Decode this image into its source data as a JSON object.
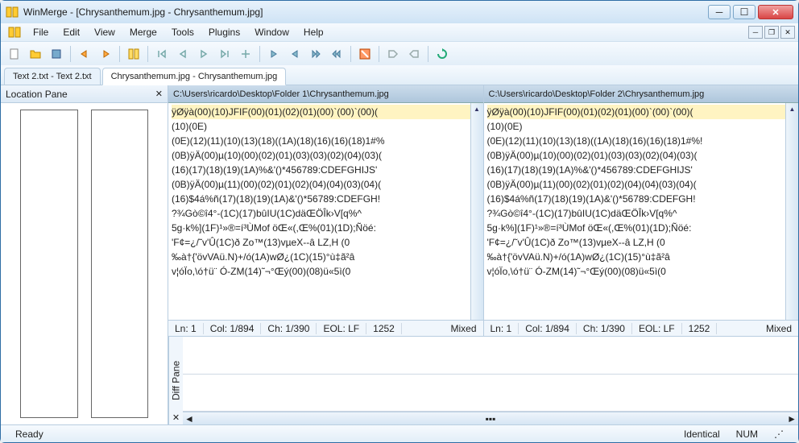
{
  "window": {
    "title": "WinMerge - [Chrysanthemum.jpg - Chrysanthemum.jpg]"
  },
  "menu": {
    "file": "File",
    "edit": "Edit",
    "view": "View",
    "merge": "Merge",
    "tools": "Tools",
    "plugins": "Plugins",
    "windowm": "Window",
    "help": "Help"
  },
  "tabs": {
    "t1": "Text 2.txt - Text 2.txt",
    "t2": "Chrysanthemum.jpg - Chrysanthemum.jpg"
  },
  "location": {
    "title": "Location Pane"
  },
  "left": {
    "path": "C:\\Users\\ricardo\\Desktop\\Folder 1\\Chrysanthemum.jpg",
    "lines": [
      "ÿØÿà(00)(10)JFIF(00)(01)(02)(01)(00)`(00)`(00)(",
      "(10)(0E)",
      "(0E)(12)(11)(10)(13)(18)((1A)(18)(16)(16)(18)1#%",
      "(0B)ÿÄ(00)µ(10)(00)(02)(01)(03)(03)(02)(04)(03)(",
      "(16)(17)(18)(19)(1A)%&'()*456789:CDEFGHIJS'",
      "(0B)ÿÄ(00)µ(11)(00)(02)(01)(02)(04)(04)(03)(04)(",
      "(16)$4á%ñ(17)(18)(19)(1A)&'()*56789:CDEFGH!",
      "?¾Gò©î4°-(1C)(17)bûIU(1C)däŒÖÎk›V[q%^",
      "5g·k%](1F)¹»®=í³ÙMof öŒ«(,Œ%(01)(1D);Ñöé:",
      "'F¢=¿/˜v'Û(1C)ð Zo™(13)vµeX--â LZ,H         (0",
      "‰à†{'övVAü.N)+/ó(1A)wØ¿(1C)(15)°ù‡ã²â",
      "v¦óÏo,\\ó†ü¨ Ó-ZM(14)˜¬°Œý(00)(08)ü«5ì(0"
    ],
    "status": {
      "ln": "Ln: 1",
      "col": "Col: 1/894",
      "ch": "Ch: 1/390",
      "eol": "EOL: LF",
      "cp": "1252",
      "mode": "Mixed"
    }
  },
  "right": {
    "path": "C:\\Users\\ricardo\\Desktop\\Folder 2\\Chrysanthemum.jpg",
    "lines": [
      "ÿØÿà(00)(10)JFIF(00)(01)(02)(01)(00)`(00)`(00)(",
      "(10)(0E)",
      "(0E)(12)(11)(10)(13)(18)((1A)(18)(16)(16)(18)1#%!",
      "(0B)ÿÄ(00)µ(10)(00)(02)(01)(03)(03)(02)(04)(03)(",
      "(16)(17)(18)(19)(1A)%&'()*456789:CDEFGHIJS'",
      "(0B)ÿÄ(00)µ(11)(00)(02)(01)(02)(04)(04)(03)(04)(",
      "(16)$4á%ñ(17)(18)(19)(1A)&'()*56789:CDEFGH!",
      "?¾Gò©î4°-(1C)(17)bûIU(1C)däŒÖÎk›V[q%^",
      "5g·k%](1F)¹»®=í³ÙMof öŒ«(,Œ%(01)(1D);Ñöé:",
      "'F¢=¿/˜v'Û(1C)ð Zo™(13)vµeX--â LZ,H         (0",
      "‰à†{'övVAü.N)+/ó(1A)wØ¿(1C)(15)°ù‡ã²â",
      "v¦óÏo,\\ó†ü¨ Ó-ZM(14)˜¬°Œý(00)(08)ü«5ì(0"
    ],
    "status": {
      "ln": "Ln: 1",
      "col": "Col: 1/894",
      "ch": "Ch: 1/390",
      "eol": "EOL: LF",
      "cp": "1252",
      "mode": "Mixed"
    }
  },
  "diffpane": {
    "label": "Diff Pane"
  },
  "statusbar": {
    "ready": "Ready",
    "identical": "Identical",
    "num": "NUM"
  }
}
